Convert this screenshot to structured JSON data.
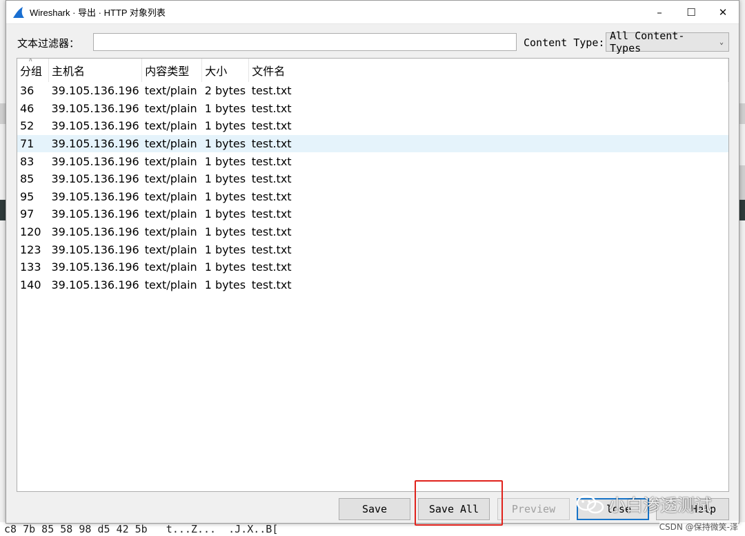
{
  "window": {
    "title": "Wireshark · 导出 · HTTP 对象列表",
    "minimize": "–",
    "maximize": "☐",
    "close": "✕"
  },
  "filter": {
    "label": "文本过滤器：",
    "value": "",
    "content_type_label": "Content Type:",
    "content_type_value": "All Content-Types"
  },
  "table": {
    "columns": [
      "分组",
      "主机名",
      "内容类型",
      "大小",
      "文件名"
    ],
    "rows": [
      [
        "36",
        "39.105.136.196",
        "text/plain",
        "2 bytes",
        "test.txt"
      ],
      [
        "46",
        "39.105.136.196",
        "text/plain",
        "1 bytes",
        "test.txt"
      ],
      [
        "52",
        "39.105.136.196",
        "text/plain",
        "1 bytes",
        "test.txt"
      ],
      [
        "71",
        "39.105.136.196",
        "text/plain",
        "1 bytes",
        "test.txt"
      ],
      [
        "83",
        "39.105.136.196",
        "text/plain",
        "1 bytes",
        "test.txt"
      ],
      [
        "85",
        "39.105.136.196",
        "text/plain",
        "1 bytes",
        "test.txt"
      ],
      [
        "95",
        "39.105.136.196",
        "text/plain",
        "1 bytes",
        "test.txt"
      ],
      [
        "97",
        "39.105.136.196",
        "text/plain",
        "1 bytes",
        "test.txt"
      ],
      [
        "120",
        "39.105.136.196",
        "text/plain",
        "1 bytes",
        "test.txt"
      ],
      [
        "123",
        "39.105.136.196",
        "text/plain",
        "1 bytes",
        "test.txt"
      ],
      [
        "133",
        "39.105.136.196",
        "text/plain",
        "1 bytes",
        "test.txt"
      ],
      [
        "140",
        "39.105.136.196",
        "text/plain",
        "1 bytes",
        "test.txt"
      ]
    ],
    "selected_row": 3
  },
  "buttons": {
    "save": "Save",
    "save_all": "Save All",
    "preview": "Preview",
    "close": "lose",
    "help": "Help"
  },
  "background": {
    "bottom_hex": "c8 7b 85 58 98 d5 42 5b   t...Z...  .J.X..B["
  },
  "watermark": {
    "text": "小白渗透测试",
    "credit": "CSDN @保持微笑-泽"
  },
  "colors": {
    "selection": "#e5f3fb",
    "highlight_box": "#e0201a",
    "default_button_border": "#1573c8",
    "wireshark_fin": "#1a6fd1"
  }
}
